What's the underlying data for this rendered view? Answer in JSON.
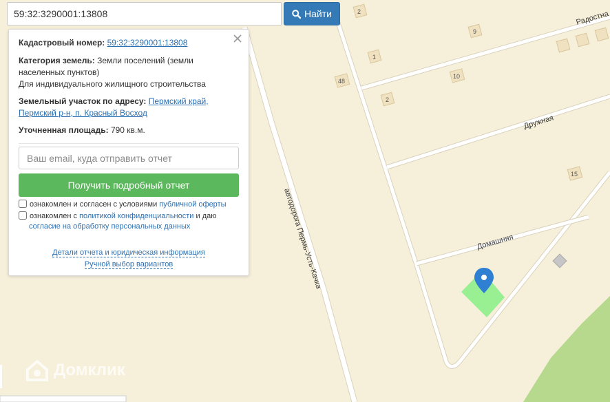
{
  "search": {
    "value": "59:32:3290001:13808",
    "button_label": "Найти"
  },
  "info": {
    "cadastral_label": "Кадастровый номер:",
    "cadastral_value": "59:32:3290001:13808",
    "category_label": "Категория земель:",
    "category_value": "Земли поселений (земли населенных пунктов)",
    "usage": "Для индивидуального жилищного строительства",
    "address_label": "Земельный участок по адресу:",
    "address_line1": "Пермский край,",
    "address_line2": "Пермский р-н, п. Красный Восход",
    "area_label": "Уточненная площадь:",
    "area_value": "790 кв.м."
  },
  "form": {
    "email_placeholder": "Ваш email, куда отправить отчет",
    "submit_label": "Получить подробный отчет",
    "consent1_prefix": "ознакомлен и согласен с условиями",
    "consent1_link": "публичной оферты",
    "consent2_prefix": "ознакомлен с",
    "consent2_link": "политикой конфиденциальности",
    "consent2_mid": "и даю",
    "consent2_link2": "согласие на обработку персональных данных"
  },
  "footer": {
    "details_link": "Детали отчета и юридическая информация",
    "manual_link": "Ручной выбор вариантов"
  },
  "map": {
    "roads": {
      "highway": "автодорога Пермь-Усть-Качка",
      "druzhnaya": "Дружная",
      "domashnyaya": "Домашняя",
      "radostnaya": "Радостна"
    },
    "house_numbers": [
      "2",
      "9",
      "1",
      "48",
      "10",
      "2",
      "15"
    ],
    "watermark": "Домклик",
    "colors": {
      "background": "#f6efda",
      "road": "#ffffff",
      "parcel": "#8ef08a",
      "marker": "#2f7fd2",
      "forest": "#b6d98d"
    }
  }
}
